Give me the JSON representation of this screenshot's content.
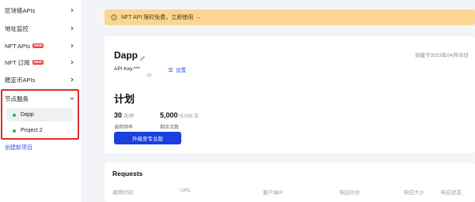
{
  "sidebar": {
    "items": [
      {
        "label": "区块链APIs",
        "new": false
      },
      {
        "label": "地址监控",
        "new": false
      },
      {
        "label": "NFT APIs",
        "new": true
      },
      {
        "label": "NFT 订阅",
        "new": true
      },
      {
        "label": "稳定币APIs",
        "new": false
      },
      {
        "label": "节点服务",
        "new": false
      }
    ],
    "new_badge": "NEW",
    "sub_items": [
      {
        "label": "Dapp",
        "active": true
      },
      {
        "label": "Project 2",
        "active": false
      }
    ],
    "create_label": "创建新项目"
  },
  "banner": {
    "text": "NFT API 限时免费，立即使用 →",
    "color": "#fbd592"
  },
  "dapp": {
    "name": "Dapp",
    "created": "创建于2023年04月05日",
    "api_key_label": "API Key:***",
    "settings_label": "设置"
  },
  "plan": {
    "title": "计划",
    "rate_value": "30",
    "rate_unit": "次/秒",
    "rate_caption": "调用频率",
    "remain_value": "5,000",
    "remain_total": "/5,000 次",
    "remain_caption": "剩余次数",
    "upgrade_label": "升级至专业版",
    "accent": "#1c3fe0"
  },
  "requests": {
    "title": "Requests",
    "columns": [
      "调用时间",
      "URL",
      "客户端IP",
      "响应时长",
      "响应大小",
      "响应状态"
    ]
  }
}
